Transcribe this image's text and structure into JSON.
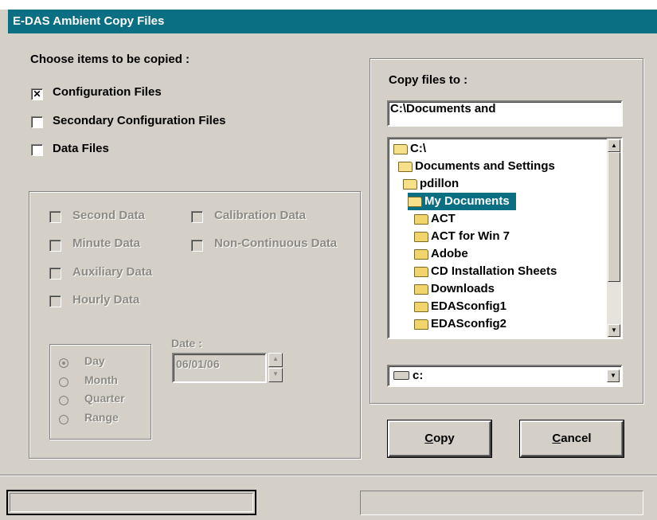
{
  "window": {
    "title": "E-DAS Ambient Copy Files"
  },
  "choose": {
    "heading": "Choose items to  be copied :",
    "config": {
      "label": "Configuration Files",
      "checked": true
    },
    "secondary": {
      "label": "Secondary Configuration Files",
      "checked": false
    },
    "data": {
      "label": "Data Files",
      "checked": false
    }
  },
  "data_options": {
    "second": "Second Data",
    "calibration": "Calibration Data",
    "minute": "Minute Data",
    "non_continuous": "Non-Continuous Data",
    "auxiliary": "Auxiliary Data",
    "hourly": "Hourly Data"
  },
  "period": {
    "day": "Day",
    "month": "Month",
    "quarter": "Quarter",
    "range": "Range",
    "selected": "Day"
  },
  "date": {
    "label": "Date :",
    "value": "06/01/06"
  },
  "copy_to": {
    "heading": "Copy files to :",
    "path_line1": "C:\\Documents and",
    "tree": [
      {
        "label": "C:\\",
        "level": 0,
        "open": true
      },
      {
        "label": "Documents and Settings",
        "level": 1,
        "open": true
      },
      {
        "label": "pdillon",
        "level": 2,
        "open": true
      },
      {
        "label": "My Documents",
        "level": 3,
        "open": true,
        "selected": true
      },
      {
        "label": "ACT",
        "level": 4
      },
      {
        "label": "ACT for Win 7",
        "level": 4
      },
      {
        "label": "Adobe",
        "level": 4
      },
      {
        "label": "CD Installation Sheets",
        "level": 4
      },
      {
        "label": "Downloads",
        "level": 4
      },
      {
        "label": "EDASconfig1",
        "level": 4
      },
      {
        "label": "EDASconfig2",
        "level": 4
      }
    ],
    "drive": "c:"
  },
  "buttons": {
    "copy_mnemonic": "C",
    "copy_rest": "opy",
    "cancel_mnemonic": "C",
    "cancel_rest": "ancel"
  },
  "colors": {
    "accent": "#0a6f83",
    "face": "#d4d0c8"
  }
}
